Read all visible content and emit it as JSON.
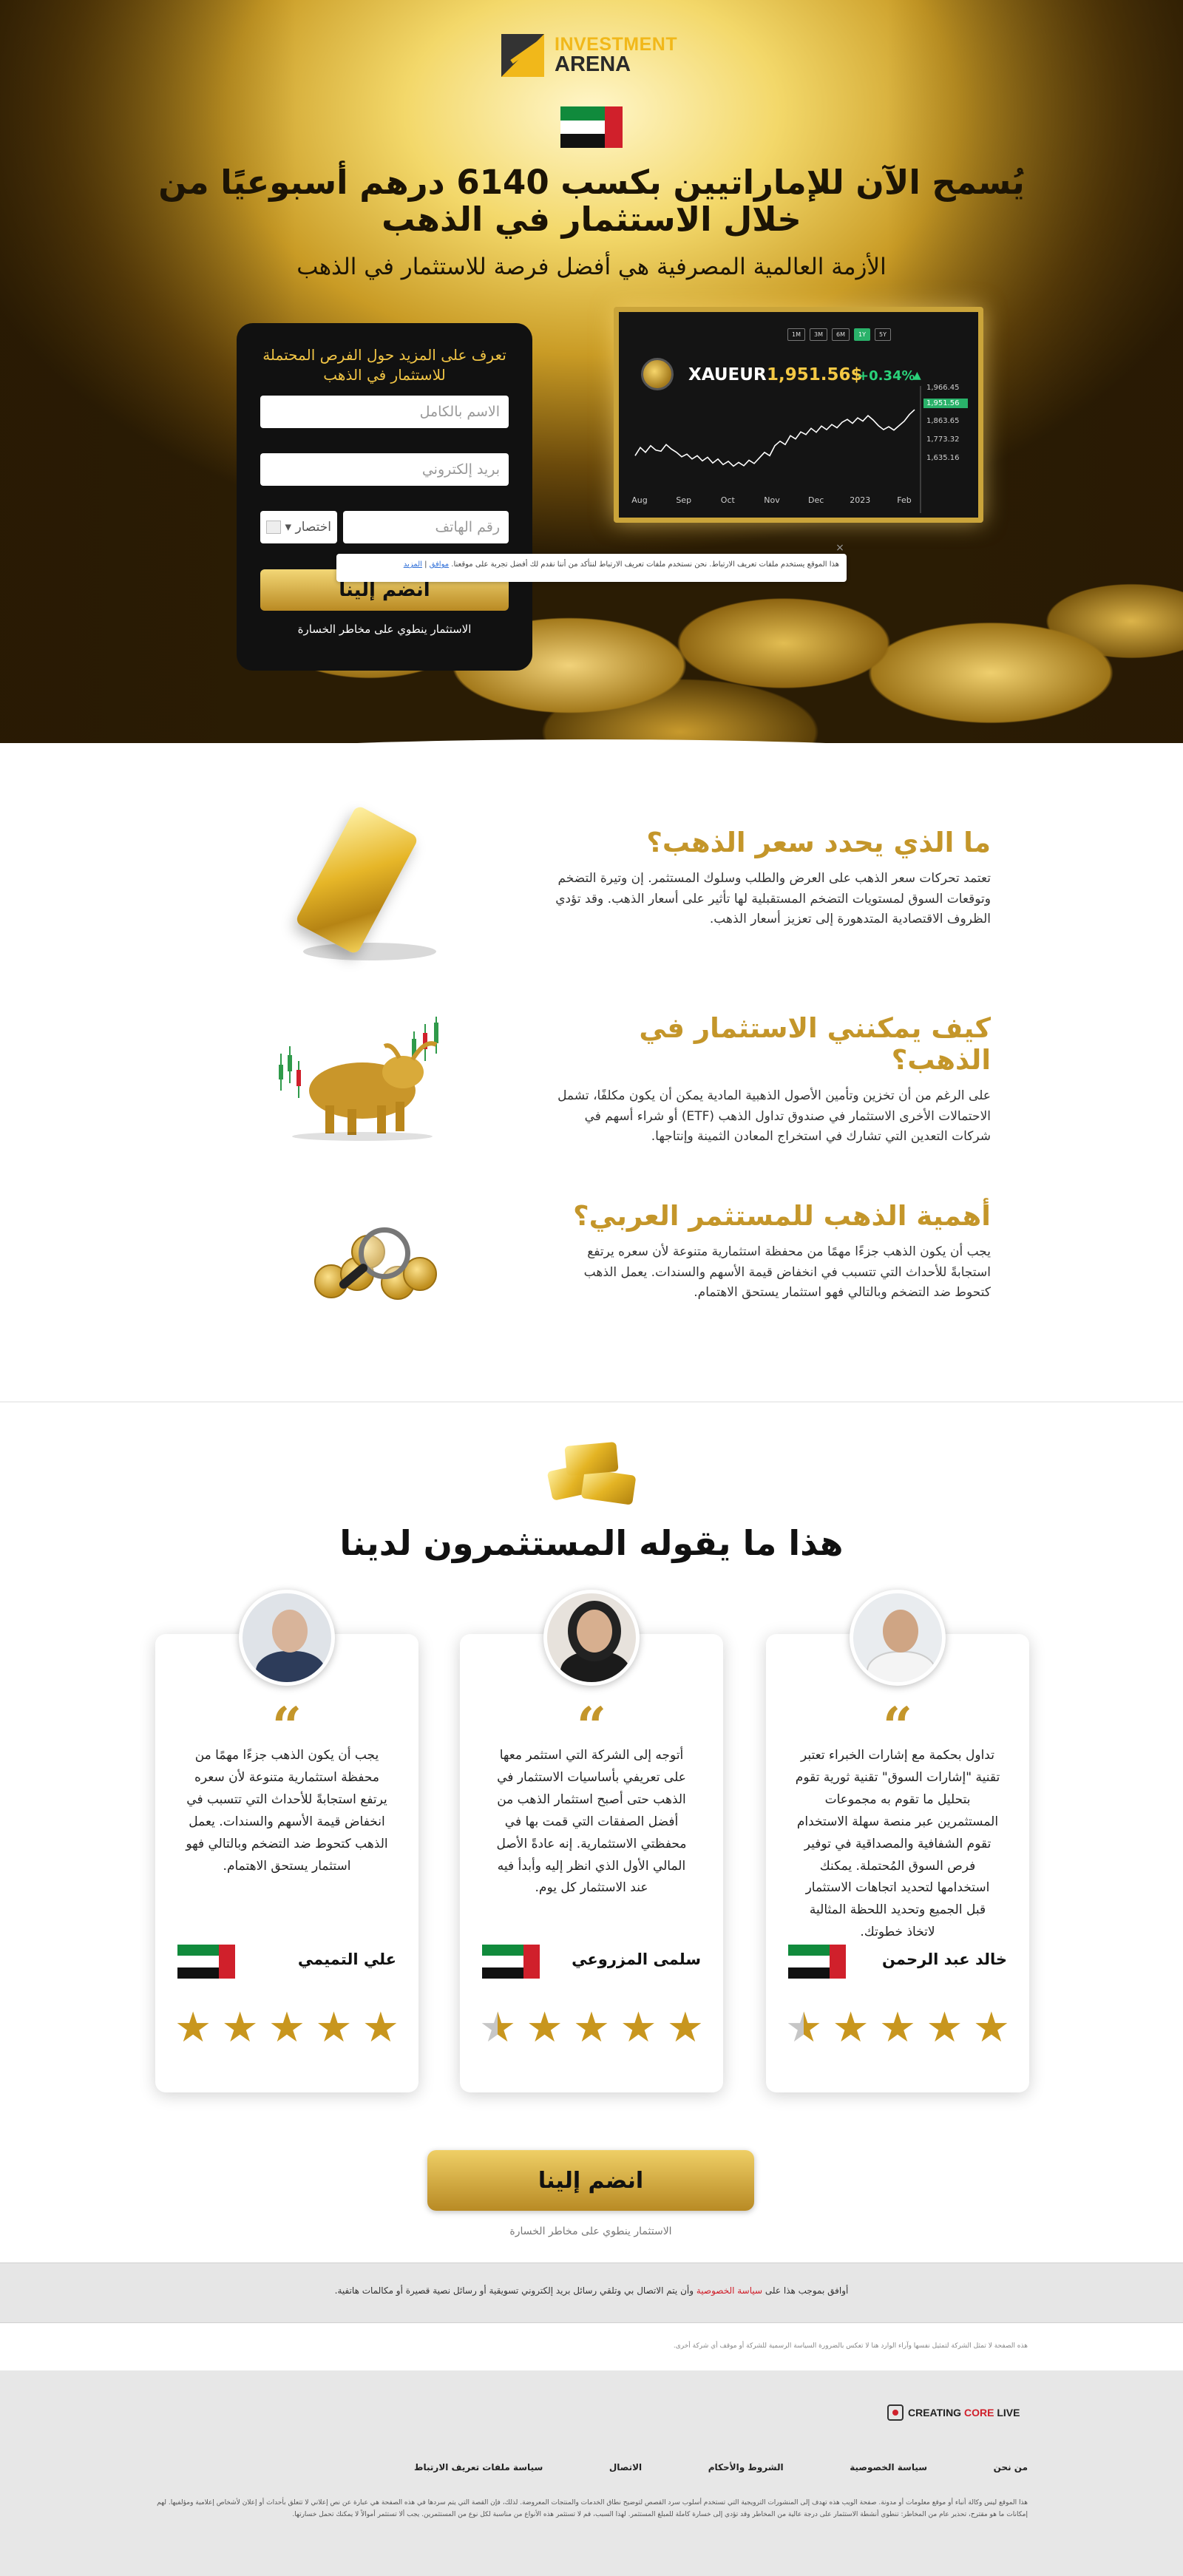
{
  "brand": {
    "logo_line1": "INVESTMENT",
    "logo_line2": "ARENA",
    "brand_colors": {
      "gold": "#f1b81a",
      "dark": "#2a2a2a"
    }
  },
  "hero": {
    "title": "يُسمح الآن للإماراتيين بكسب 6140 درهم أسبوعيًا من خلال الاستثمار في الذهب",
    "subtitle": "الأزمة العالمية المصرفية هي أفضل فرصة للاستثمار في الذهب",
    "flag": "uae-flag"
  },
  "chart_widget": {
    "tabs": [
      "1M",
      "3M",
      "6M",
      "1Y",
      "5Y"
    ],
    "active_tab": "1Y",
    "symbol": "XAUEUR",
    "price": "1,951.56$",
    "change": "+0.34%",
    "colors": {
      "up": "#2ad27a",
      "price": "#f4c844"
    }
  },
  "chart_data": {
    "type": "line",
    "title": "",
    "xlabel": "",
    "ylabel": "",
    "x_tick_labels": [
      "Aug",
      "Sep",
      "Oct",
      "Nov",
      "Dec",
      "2023",
      "Feb"
    ],
    "y_tick_labels": [
      "1,966.45",
      "1,951.56",
      "1,863.65",
      "1,773.32",
      "1,635.16"
    ],
    "ylim": [
      1620,
      1975
    ],
    "current_value": 1951.56,
    "series": [
      {
        "values": [
          1745,
          1782,
          1760,
          1790,
          1770,
          1765,
          1795,
          1775,
          1760,
          1740,
          1752,
          1730,
          1745,
          1722,
          1738,
          1712,
          1730,
          1705,
          1720,
          1698,
          1715,
          1700,
          1725,
          1710,
          1735,
          1760,
          1745,
          1790,
          1810,
          1795,
          1835,
          1820,
          1852,
          1840,
          1868,
          1850,
          1878,
          1862,
          1885,
          1870,
          1895,
          1908,
          1890,
          1915,
          1900,
          1925,
          1905,
          1880,
          1862,
          1875,
          1860,
          1880,
          1900,
          1930,
          1951.56
        ]
      }
    ],
    "grid": false
  },
  "form": {
    "title": "تعرف على المزيد حول الفرص المحتملة للاستثمار في الذهب",
    "name_placeholder": "الاسم بالكامل",
    "email_placeholder": "بريد إلكتروني",
    "phone_placeholder": "رقم الهاتف",
    "country_code": "اختصار",
    "submit_label": "انضم إلينا",
    "risk_note": "الاستثمار ينطوي على مخاطر الخسارة"
  },
  "cookie_notice": {
    "text": "هذا الموقع يستخدم ملفات تعريف الارتباط. نحن نستخدم ملفات تعريف الارتباط لنتأكد من أننا نقدم لك أفضل تجربة على موقعنا.",
    "accept_link": "موافق",
    "more_link": "المزيد",
    "close": "×"
  },
  "info_blocks": [
    {
      "heading": "ما الذي يحدد سعر الذهب؟",
      "body": "تعتمد تحركات سعر الذهب على العرض والطلب وسلوك المستثمر. إن وتيرة التضخم وتوقعات السوق لمستويات التضخم المستقبلية لها تأثير على أسعار الذهب. وقد تؤدي الظروف الاقتصادية المتدهورة إلى تعزيز أسعار الذهب."
    },
    {
      "heading": "كيف يمكنني الاستثمار في الذهب؟",
      "body": "على الرغم من أن تخزين وتأمين الأصول الذهبية المادية يمكن أن يكون مكلفًا، تشمل الاحتمالات الأخرى الاستثمار في صندوق تداول الذهب (ETF) أو شراء أسهم في شركات التعدين التي تشارك في استخراج المعادن الثمينة وإنتاجها."
    },
    {
      "heading": "أهمية الذهب للمستثمر العربي؟",
      "body": "يجب أن يكون الذهب جزءًا مهمًا من محفظة استثمارية متنوعة لأن سعره يرتفع استجابةً للأحداث التي تتسبب في انخفاض قيمة الأسهم والسندات. يعمل الذهب كتحوط ضد التضخم وبالتالي فهو استثمار يستحق الاهتمام."
    }
  ],
  "testimonials": {
    "title": "هذا ما يقوله المستثمرون لدينا",
    "quote_glyph": "“",
    "items": [
      {
        "name": "علي التميمي",
        "text": "يجب أن يكون الذهب جزءًا مهمًا من محفظة استثمارية متنوعة لأن سعره يرتفع استجابةً للأحداث التي تتسبب في انخفاض قيمة الأسهم والسندات. يعمل الذهب كتحوط ضد التضخم وبالتالي فهو استثمار يستحق الاهتمام.",
        "rating": 5
      },
      {
        "name": "سلمى المزروعي",
        "text": "أتوجه إلى الشركة التي استثمر معها على تعريفي بأساسيات الاستثمار في الذهب حتى أصبح استثمار الذهب من أفضل الصفقات التي قمت بها في محفظتي الاستثمارية. إنه عادةً الأصل المالي الأول الذي انظر إليه وأبدأ فيه عند الاستثمار كل يوم.",
        "rating": 4.5
      },
      {
        "name": "خالد عبد الرحمن",
        "text": "تداول بحكمة مع إشارات الخبراء تعتبر تقنية \"إشارات السوق\" تقنية ثورية تقوم بتحليل ما تقوم به مجموعات المستثمرين عبر منصة سهلة الاستخدام تقوم الشفافية والمصداقية في توفير فرص السوق المُحتملة. يمكنك استخدامها لتحديد اتجاهات الاستثمار قبل الجميع وتحديد اللحظة المثالية لاتخاذ خطوتك.",
        "rating": 4.5
      }
    ]
  },
  "cta": {
    "label": "انضم إلينا",
    "risk_note": "الاستثمار ينطوي على مخاطر الخسارة"
  },
  "consent": {
    "prefix": "أوافق بموجب هذا على",
    "privacy_link": "سياسة الخصوصية",
    "suffix": "وأن يتم الاتصال بي وتلقي رسائل بريد إلكتروني تسويقية أو رسائل نصية قصيرة أو مكالمات هاتفية."
  },
  "disclaimer_line": "هذه الصفحة لا تمثل الشركة لتمثيل نفسها وآراء الوارد هنا لا تعكس بالضرورة السياسة الرسمية للشركة أو موقف أي شركة أخرى.",
  "footer": {
    "logo_part1": "CREATING",
    "logo_part2": "CORE",
    "logo_part3": "LIVE",
    "links": [
      "من نحن",
      "سياسة الخصوصية",
      "الشروط والأحكام",
      "الاتصال",
      "سياسة ملفات تعريف الارتباط"
    ],
    "legal": "هذا الموقع ليس وكالة أنباء أو موقع معلومات أو مدونة. صفحة الويب هذه تهدف إلى المنشورات الترويجية التي تستخدم أسلوب سرد القصص لتوضيح نطاق الخدمات والمنتجات المعروضة. لذلك، فإن القصة التي يتم سردها في هذه الصفحة هي عبارة عن نص إعلاني لا تتعلق بأحداث أو إعلان لأشخاص إعلامية ومؤلفيها. لهم إمكانات ما هو مقترح، تحذير عام من المخاطر: تنطوي أنشطة الاستثمار على درجة عالية من المخاطر وقد تؤدي إلى خسارة كاملة للمبلغ المستثمر. لهذا السبب، قم لا تستثمر هذه الأنواع من مناسبة لكل نوع من المستثمرين. يجب ألا تستثمر أموالاً لا يمكنك تحمل خسارتها."
  }
}
